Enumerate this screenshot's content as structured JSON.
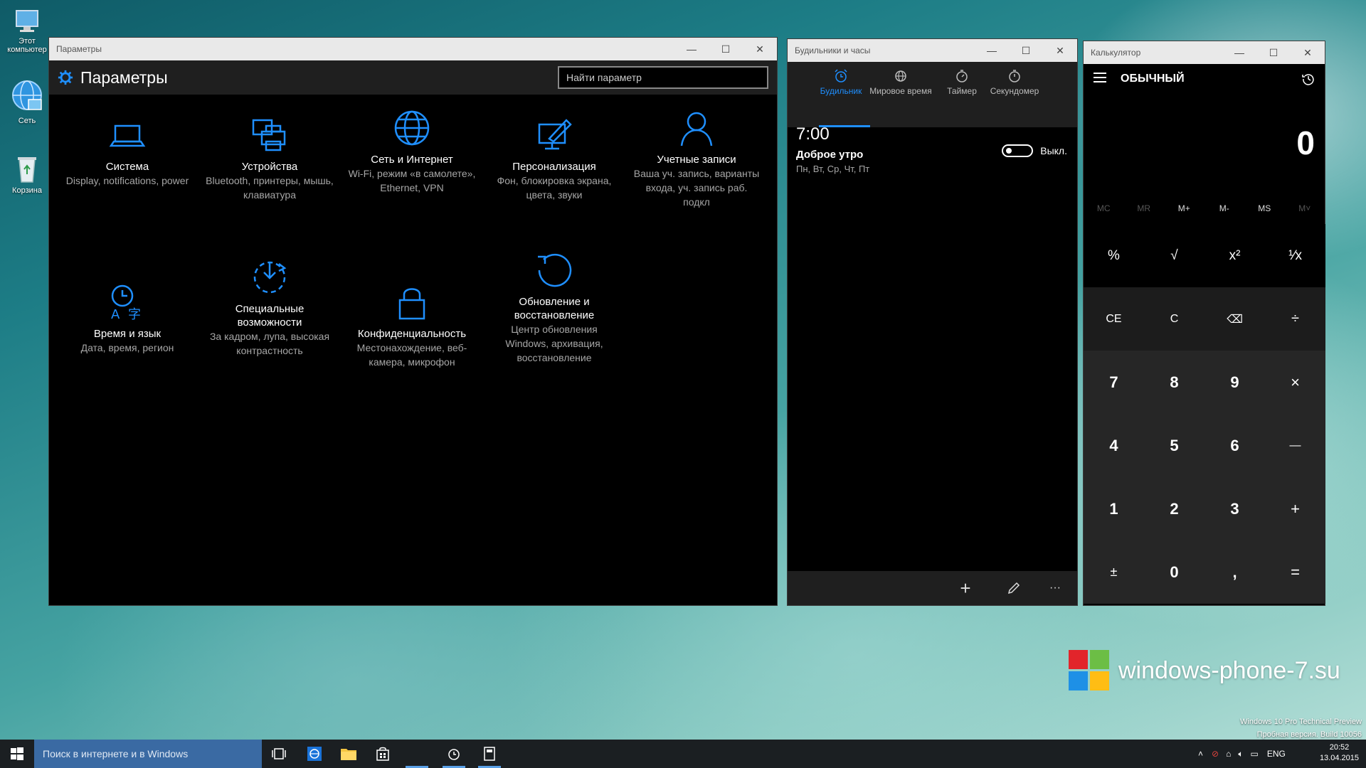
{
  "desktop": {
    "icons": [
      {
        "label_1": "Этот",
        "label_2": "компьютер"
      },
      {
        "label_1": "Сеть"
      },
      {
        "label_1": "Корзина"
      }
    ]
  },
  "settings": {
    "window_title": "Параметры",
    "header_title": "Параметры",
    "search_placeholder": "Найти параметр",
    "tiles": [
      {
        "name": "Система",
        "desc": "Display, notifications, power"
      },
      {
        "name": "Устройства",
        "desc": "Bluetooth, принтеры, мышь, клавиатура"
      },
      {
        "name": "Сеть и Интернет",
        "desc": "Wi-Fi, режим «в самолете», Ethernet, VPN"
      },
      {
        "name": "Персонализация",
        "desc": "Фон, блокировка экрана, цвета, звуки"
      },
      {
        "name": "Учетные записи",
        "desc": "Ваша уч. запись, варианты входа, уч. запись раб. подкл"
      },
      {
        "name": "Время и язык",
        "desc": "Дата, время, регион"
      },
      {
        "name": "Специальные возможности",
        "desc": "За кадром, лупа, высокая контрастность"
      },
      {
        "name": "Конфиденциальность",
        "desc": "Местонахождение, веб-камера, микрофон"
      },
      {
        "name": "Обновление и восстановление",
        "desc": "Центр обновления Windows, архивация, восстановление"
      }
    ],
    "accent_color": "#1f8fff"
  },
  "alarms": {
    "window_title": "Будильники и часы",
    "tabs": [
      {
        "label": "Будильник",
        "icon": "alarm-clock-icon",
        "active": true
      },
      {
        "label": "Мировое время",
        "icon": "globe-icon",
        "active": false
      },
      {
        "label": "Таймер",
        "icon": "timer-icon",
        "active": false
      },
      {
        "label": "Секундомер",
        "icon": "stopwatch-icon",
        "active": false
      }
    ],
    "alarm": {
      "time": "7:00",
      "name": "Доброе утро",
      "days": "Пн, Вт, Ср, Чт, Пт",
      "toggle_label": "Выкл.",
      "enabled": false
    },
    "bottom": {
      "add": "+",
      "edit_icon": "pencil-icon",
      "more": "···"
    }
  },
  "calculator": {
    "window_title": "Калькулятор",
    "mode": "ОБЫЧНЫЙ",
    "display": "0",
    "memory": [
      {
        "label": "MC",
        "enabled": false
      },
      {
        "label": "MR",
        "enabled": false
      },
      {
        "label": "M+",
        "enabled": true
      },
      {
        "label": "M-",
        "enabled": true
      },
      {
        "label": "MS",
        "enabled": true
      },
      {
        "label": "M˅",
        "enabled": false
      }
    ],
    "keys": {
      "percent": "%",
      "sqrt": "√",
      "square": "x²",
      "reciprocal": "¹⁄x",
      "ce": "CE",
      "c": "C",
      "backspace": "⌫",
      "divide": "÷",
      "n7": "7",
      "n8": "8",
      "n9": "9",
      "multiply": "×",
      "n4": "4",
      "n5": "5",
      "n6": "6",
      "minus": "—",
      "n1": "1",
      "n2": "2",
      "n3": "3",
      "plus": "+",
      "negate": "±",
      "n0": "0",
      "decimal": ",",
      "equals": "="
    }
  },
  "watermark": {
    "text": "windows-phone-7.su",
    "build_line_1": "Windows 10 Pro Technical Preview",
    "build_line_2": "Пробная версия. Build 10056"
  },
  "taskbar": {
    "search_placeholder": "Поиск в интернете и в Windows",
    "language": "ENG",
    "time": "20:52",
    "date": "13.04.2015"
  }
}
